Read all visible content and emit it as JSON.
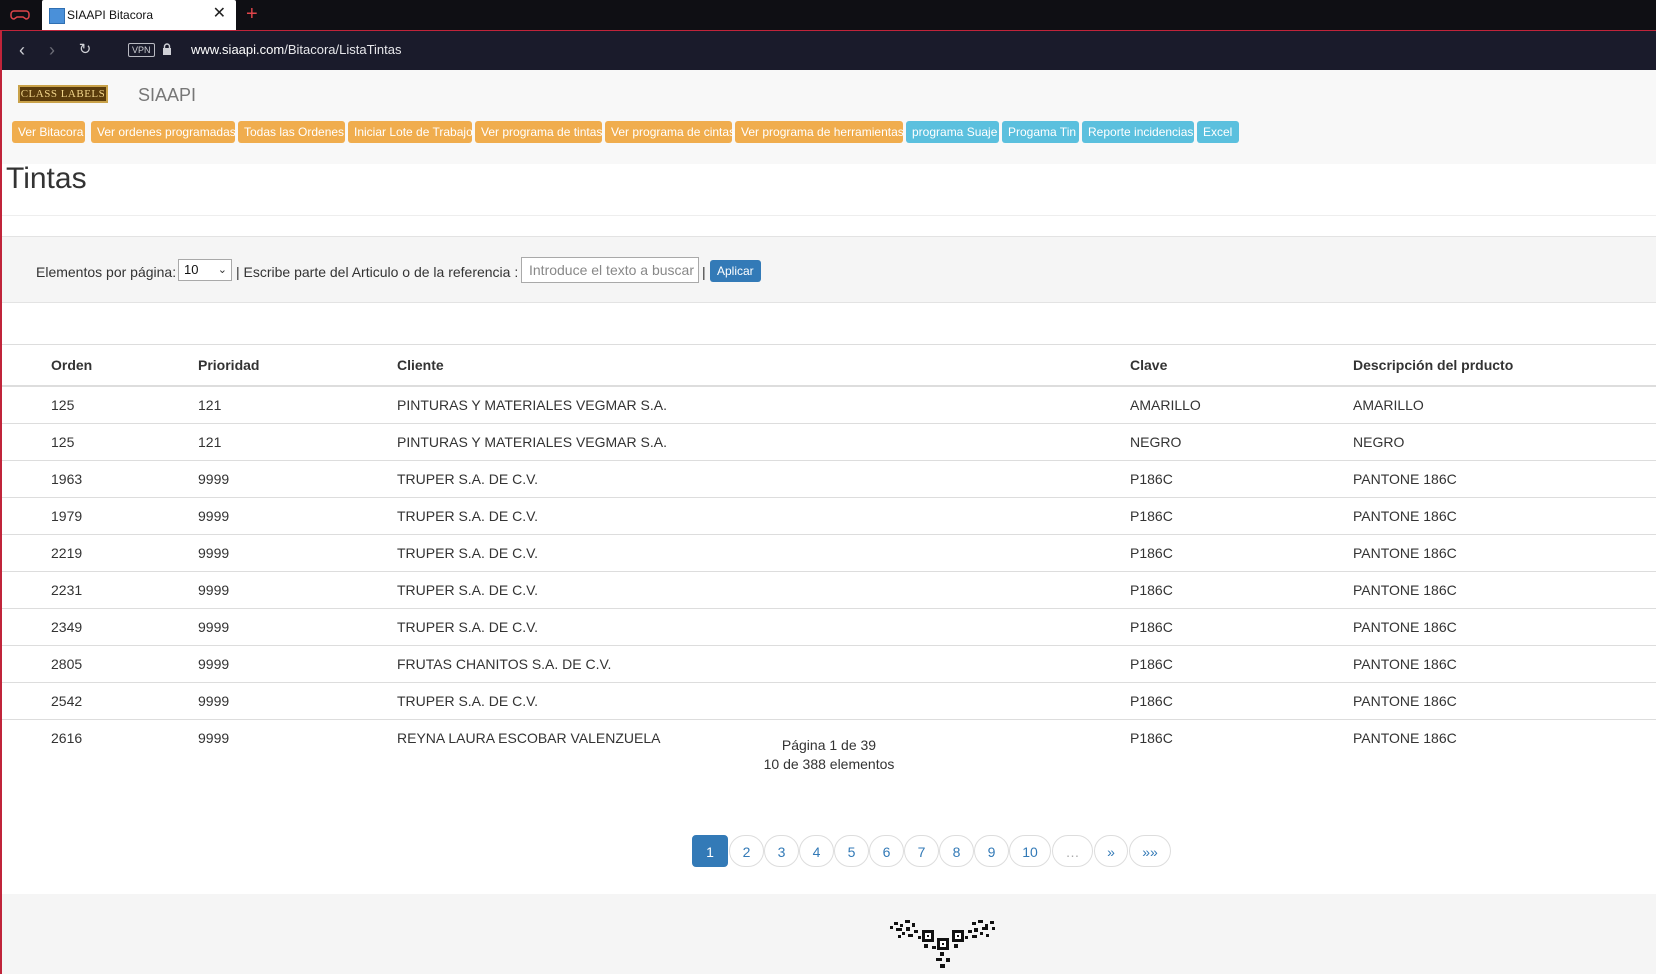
{
  "browser": {
    "tab_title": "SIAAPI Bitacora",
    "url_host": "www.siaapi.com",
    "url_path": "/Bitacora/ListaTintas",
    "vpn_label": "VPN",
    "close_glyph": "✕",
    "new_tab_glyph": "+"
  },
  "header": {
    "logo_text": "CLASS LABELS",
    "brand": "SIAAPI"
  },
  "menu": [
    {
      "label": "Ver Bitacora",
      "color": "#f0ad4e"
    },
    {
      "label": "Ver ordenes programadas",
      "color": "#f0ad4e"
    },
    {
      "label": "Todas las Ordenes",
      "color": "#f0ad4e"
    },
    {
      "label": "Iniciar Lote de Trabajo",
      "color": "#f0ad4e"
    },
    {
      "label": "Ver programa de tintas",
      "color": "#f0ad4e"
    },
    {
      "label": "Ver programa de cintas",
      "color": "#f0ad4e"
    },
    {
      "label": "Ver programa de herramientas",
      "color": "#f0ad4e"
    },
    {
      "label": "programa Suaje",
      "color": "#5bc0de"
    },
    {
      "label": "Progama Tin",
      "color": "#5bc0de"
    },
    {
      "label": "Reporte incidencias",
      "color": "#5bc0de"
    },
    {
      "label": "Excel",
      "color": "#5bc0de"
    }
  ],
  "page_title": "Tintas",
  "filter": {
    "per_page_label": "Elementos por página:",
    "per_page_value": "10",
    "search_label": "| Escribe parte del Articulo o de la referencia :",
    "search_placeholder": "Introduce el texto a buscar",
    "separator": "|",
    "apply_label": "Aplicar"
  },
  "table": {
    "headers": [
      "Orden",
      "Prioridad",
      "Cliente",
      "Clave",
      "Descripción del prducto"
    ],
    "rows": [
      [
        "125",
        "121",
        "PINTURAS Y MATERIALES VEGMAR S.A.",
        "AMARILLO",
        "AMARILLO"
      ],
      [
        "125",
        "121",
        "PINTURAS Y MATERIALES VEGMAR S.A.",
        "NEGRO",
        "NEGRO"
      ],
      [
        "1963",
        "9999",
        "TRUPER S.A. DE C.V.",
        "P186C",
        "PANTONE 186C"
      ],
      [
        "1979",
        "9999",
        "TRUPER S.A. DE C.V.",
        "P186C",
        "PANTONE 186C"
      ],
      [
        "2219",
        "9999",
        "TRUPER S.A. DE C.V.",
        "P186C",
        "PANTONE 186C"
      ],
      [
        "2231",
        "9999",
        "TRUPER S.A. DE C.V.",
        "P186C",
        "PANTONE 186C"
      ],
      [
        "2349",
        "9999",
        "TRUPER S.A. DE C.V.",
        "P186C",
        "PANTONE 186C"
      ],
      [
        "2805",
        "9999",
        "FRUTAS CHANITOS S.A. DE C.V.",
        "P186C",
        "PANTONE 186C"
      ],
      [
        "2542",
        "9999",
        "TRUPER S.A. DE C.V.",
        "P186C",
        "PANTONE 186C"
      ],
      [
        "2616",
        "9999",
        "REYNA LAURA ESCOBAR VALENZUELA",
        "P186C",
        "PANTONE 186C"
      ]
    ]
  },
  "pager": {
    "page_info": "Página 1 de 39",
    "count_info": "10 de 388 elementos",
    "pages": [
      "1",
      "2",
      "3",
      "4",
      "5",
      "6",
      "7",
      "8",
      "9",
      "10",
      "…",
      "»",
      "»»"
    ],
    "active_page": "1"
  }
}
